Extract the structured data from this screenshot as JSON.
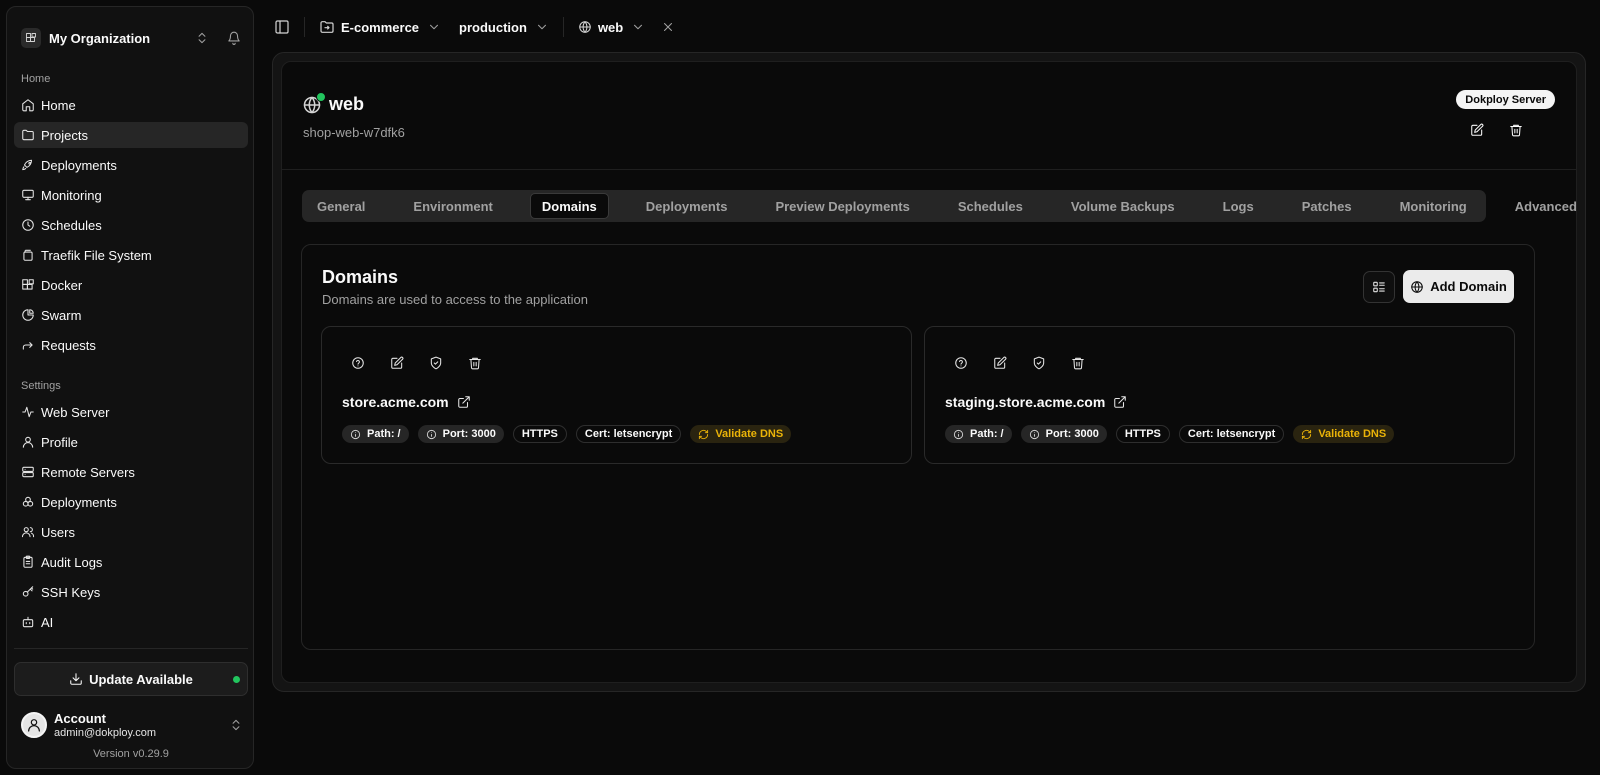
{
  "sidebar": {
    "org_name": "My Organization",
    "groups": {
      "home": "Home",
      "settings": "Settings"
    },
    "home_items": [
      {
        "label": "Home",
        "icon": "home-icon"
      },
      {
        "label": "Projects",
        "icon": "folder-icon"
      },
      {
        "label": "Deployments",
        "icon": "rocket-icon"
      },
      {
        "label": "Monitoring",
        "icon": "monitor-icon"
      },
      {
        "label": "Schedules",
        "icon": "clock-icon"
      },
      {
        "label": "Traefik File System",
        "icon": "files-icon"
      },
      {
        "label": "Docker",
        "icon": "blocks-icon"
      },
      {
        "label": "Swarm",
        "icon": "pie-chart-icon"
      },
      {
        "label": "Requests",
        "icon": "forward-icon"
      }
    ],
    "settings_items": [
      {
        "label": "Web Server",
        "icon": "activity-icon"
      },
      {
        "label": "Profile",
        "icon": "user-icon"
      },
      {
        "label": "Remote Servers",
        "icon": "server-icon"
      },
      {
        "label": "Deployments",
        "icon": "boxes-icon"
      },
      {
        "label": "Users",
        "icon": "users-icon"
      },
      {
        "label": "Audit Logs",
        "icon": "clipboard-icon"
      },
      {
        "label": "SSH Keys",
        "icon": "key-icon"
      },
      {
        "label": "AI",
        "icon": "bot-icon"
      }
    ],
    "active_item": "Projects",
    "update_label": "Update Available",
    "account": {
      "name": "Account",
      "email": "admin@dokploy.com"
    },
    "version": "Version v0.29.9"
  },
  "topbar": {
    "project": "E-commerce",
    "environment": "production",
    "service": "web"
  },
  "service": {
    "name": "web",
    "id": "shop-web-w7dfk6",
    "server_badge": "Dokploy Server",
    "status_color": "#22c55e"
  },
  "tabs": [
    "General",
    "Environment",
    "Domains",
    "Deployments",
    "Preview Deployments",
    "Schedules",
    "Volume Backups",
    "Logs",
    "Patches",
    "Monitoring",
    "Advanced"
  ],
  "active_tab": "Domains",
  "domains": {
    "title": "Domains",
    "description": "Domains are used to access to the application",
    "add_label": "Add Domain",
    "items": [
      {
        "host": "store.acme.com",
        "path": "Path: /",
        "port": "Port: 3000",
        "https": "HTTPS",
        "cert": "Cert: letsencrypt",
        "validate": "Validate DNS"
      },
      {
        "host": "staging.store.acme.com",
        "path": "Path: /",
        "port": "Port: 3000",
        "https": "HTTPS",
        "cert": "Cert: letsencrypt",
        "validate": "Validate DNS"
      }
    ]
  },
  "colors": {
    "accent_green": "#22c55e",
    "warning": "#eab308",
    "background": "#0a0a0a"
  }
}
